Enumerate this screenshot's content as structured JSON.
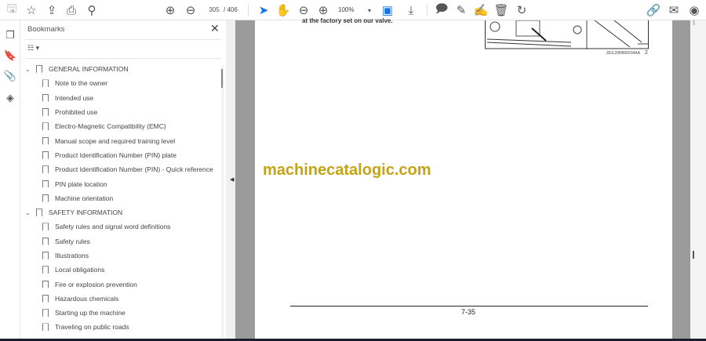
{
  "toolbar": {
    "page_current": "305",
    "page_total": "/ 406",
    "zoom": "100%",
    "icons": [
      "save-icon",
      "star-icon",
      "cloud-upload-icon",
      "print-icon",
      "find-icon",
      "page-up-icon",
      "page-down-icon",
      "select-cursor-icon",
      "hand-icon",
      "zoom-out-icon",
      "zoom-in-icon",
      "page-display-icon",
      "scroll-mode-icon",
      "comment-icon",
      "highlight-pen-icon",
      "sign-icon",
      "delete-icon",
      "rotate-icon",
      "share-link-icon",
      "email-icon",
      "account-icon"
    ]
  },
  "panel": {
    "title": "Bookmarks",
    "items": [
      {
        "label": "GENERAL INFORMATION",
        "level": 0
      },
      {
        "label": "Note to the owner",
        "level": 1
      },
      {
        "label": "Intended use",
        "level": 1
      },
      {
        "label": "Prohibited use",
        "level": 1
      },
      {
        "label": "Electro-Magnetic Compatibility (EMC)",
        "level": 1
      },
      {
        "label": "Manual scope and required training level",
        "level": 1
      },
      {
        "label": "Product Identification Number (PIN) plate",
        "level": 1
      },
      {
        "label": "Product Identification Number (PIN) - Quick reference",
        "level": 1
      },
      {
        "label": "PIN plate location",
        "level": 1
      },
      {
        "label": "Machine orientation",
        "level": 1
      },
      {
        "label": "SAFETY INFORMATION",
        "level": 0
      },
      {
        "label": "Safety rules and signal word definitions",
        "level": 1
      },
      {
        "label": "Safety rules",
        "level": 1
      },
      {
        "label": "Illustrations",
        "level": 1
      },
      {
        "label": "Local obligations",
        "level": 1
      },
      {
        "label": "Fire or explosion prevention",
        "level": 1
      },
      {
        "label": "Hazardous chemicals",
        "level": 1
      },
      {
        "label": "Starting up the machine",
        "level": 1
      },
      {
        "label": "Traveling on public roads",
        "level": 1
      }
    ]
  },
  "document": {
    "top_text": "at the factory set on our valve.",
    "figure_code": "ZEIL20R800034AA",
    "figure_num": "2",
    "watermark": "machinecatalogic.com",
    "page_number": "7-35"
  },
  "colors": {
    "watermark": "#c4a315",
    "accent": "#1473e6"
  }
}
